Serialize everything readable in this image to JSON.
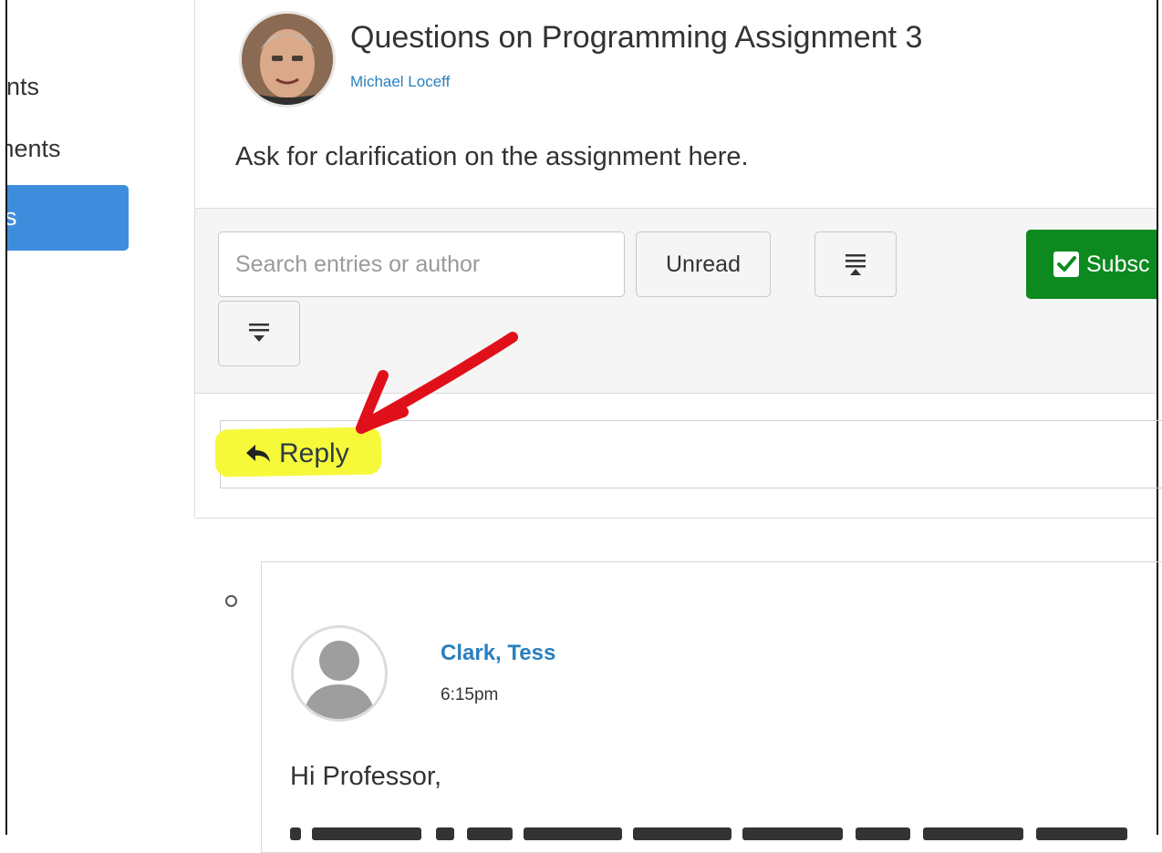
{
  "sidebar": {
    "items": [
      {
        "label": "ents",
        "active": false
      },
      {
        "label": "ements",
        "active": false
      },
      {
        "label": "ns",
        "active": true
      }
    ]
  },
  "topic": {
    "title": "Questions on Programming Assignment 3",
    "author": "Michael Loceff",
    "description": "Ask for clarification on the assignment here."
  },
  "toolbar": {
    "search_placeholder": "Search entries or author",
    "search_value": "",
    "unread_label": "Unread",
    "subscribe_label": "Subsc",
    "collapse_icon": "collapse-threads-icon",
    "expand_icon": "expand-threads-icon"
  },
  "reply": {
    "label": "Reply",
    "icon": "reply-arrow-icon"
  },
  "entry": {
    "author": "Clark, Tess",
    "time": "6:15pm",
    "greeting": "Hi Professor,"
  },
  "colors": {
    "accent_blue": "#3e8ddd",
    "link_blue": "#2a7fbf",
    "subscribe_green": "#0d8a1f",
    "highlight_yellow": "#f6f93a",
    "annotation_red": "#e0101a"
  }
}
